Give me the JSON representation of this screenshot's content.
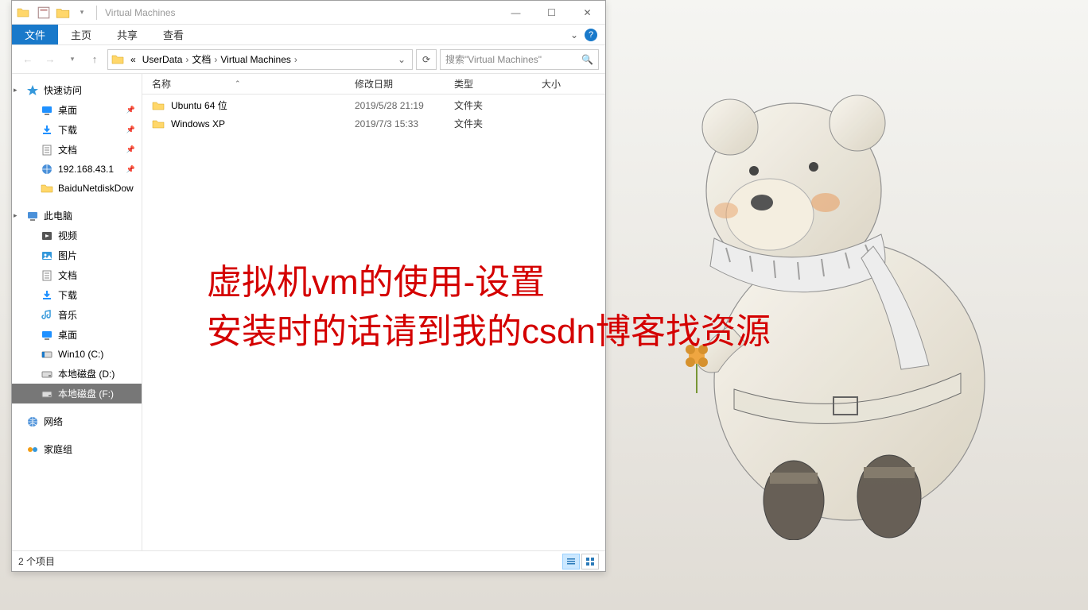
{
  "window": {
    "title": "Virtual Machines",
    "controls": {
      "min": "—",
      "max": "☐",
      "close": "✕"
    }
  },
  "ribbon": {
    "file": "文件",
    "home": "主页",
    "share": "共享",
    "view": "查看"
  },
  "address": {
    "crumb_prefix": "«",
    "crumbs": [
      "UserData",
      "文档",
      "Virtual Machines"
    ],
    "search_placeholder": "搜索\"Virtual Machines\""
  },
  "sidebar": {
    "quick_access": "快速访问",
    "quick_items": [
      {
        "icon": "desktop",
        "label": "桌面",
        "pinned": true
      },
      {
        "icon": "download",
        "label": "下载",
        "pinned": true
      },
      {
        "icon": "doc",
        "label": "文档",
        "pinned": true
      },
      {
        "icon": "net",
        "label": "192.168.43.1",
        "pinned": true
      },
      {
        "icon": "folder",
        "label": "BaiduNetdiskDow",
        "pinned": false
      }
    ],
    "this_pc": "此电脑",
    "pc_items": [
      {
        "icon": "video",
        "label": "视频"
      },
      {
        "icon": "picture",
        "label": "图片"
      },
      {
        "icon": "doc",
        "label": "文档"
      },
      {
        "icon": "download",
        "label": "下载"
      },
      {
        "icon": "music",
        "label": "音乐"
      },
      {
        "icon": "desktop",
        "label": "桌面"
      },
      {
        "icon": "disk-win",
        "label": "Win10 (C:)"
      },
      {
        "icon": "disk",
        "label": "本地磁盘 (D:)"
      },
      {
        "icon": "disk",
        "label": "本地磁盘 (F:)",
        "selected": true
      }
    ],
    "network": "网络",
    "homegroup": "家庭组"
  },
  "columns": {
    "name": "名称",
    "date": "修改日期",
    "type": "类型",
    "size": "大小"
  },
  "files": [
    {
      "name": "Ubuntu 64 位",
      "date": "2019/5/28 21:19",
      "type": "文件夹",
      "size": ""
    },
    {
      "name": "Windows XP",
      "date": "2019/7/3 15:33",
      "type": "文件夹",
      "size": ""
    }
  ],
  "status": {
    "count": "2 个项目"
  },
  "overlay": {
    "line1": "虚拟机vm的使用-设置",
    "line2": "安装时的话请到我的csdn博客找资源"
  }
}
